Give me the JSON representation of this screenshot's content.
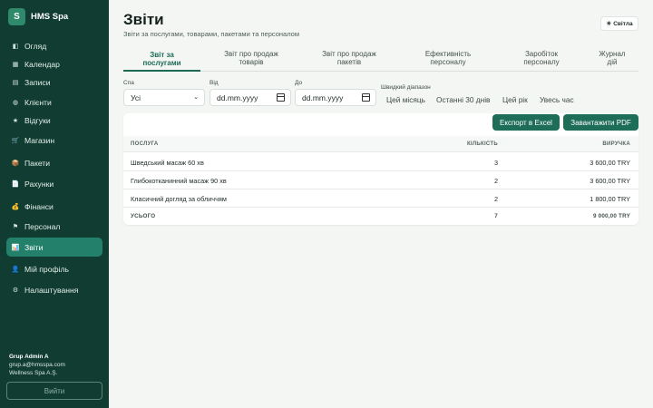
{
  "brand": {
    "logo_letter": "S",
    "name": "HMS Spa"
  },
  "nav": [
    {
      "label": "Огляд",
      "icon": "overview-icon",
      "glyph": "◧"
    },
    {
      "label": "Календар",
      "icon": "calendar-icon",
      "glyph": "▦"
    },
    {
      "label": "Записи",
      "icon": "appointments-icon",
      "glyph": "▤"
    },
    {
      "label": "Клієнти",
      "icon": "clients-icon",
      "glyph": "◍"
    },
    {
      "label": "Відгуки",
      "icon": "star-icon",
      "glyph": "★"
    },
    {
      "label": "Магазин",
      "icon": "shop-icon",
      "glyph": "🛒"
    },
    {
      "label": "Пакети",
      "icon": "package-icon",
      "glyph": "📦"
    },
    {
      "label": "Рахунки",
      "icon": "invoice-icon",
      "glyph": "📄"
    },
    {
      "label": "Фінанси",
      "icon": "finance-icon",
      "glyph": "💰"
    },
    {
      "label": "Персонал",
      "icon": "flag-icon",
      "glyph": "⚑"
    },
    {
      "label": "Звіти",
      "icon": "chart-icon",
      "glyph": "📊",
      "active": true
    },
    {
      "label": "Мій профіль",
      "icon": "profile-icon",
      "glyph": "👤"
    },
    {
      "label": "Налаштування",
      "icon": "gear-icon",
      "glyph": "⚙"
    }
  ],
  "user": {
    "name": "Grup Admin A",
    "email": "grup.a@hmsspa.com",
    "company": "Wellness Spa A.Ş."
  },
  "logout_label": "Вийти",
  "page": {
    "title": "Звіти",
    "subtitle": "Звіти за послугами, товарами, пакетами та персоналом"
  },
  "theme_toggle": {
    "icon": "sun-icon",
    "glyph": "☀",
    "label": "Світла"
  },
  "tabs": [
    {
      "line1": "Звіт за",
      "line2": "послугами",
      "active": true
    },
    {
      "line1": "Звіт про продаж",
      "line2": "товарів"
    },
    {
      "line1": "Звіт про продаж",
      "line2": "пакетів"
    },
    {
      "line1": "Ефективність",
      "line2": "персоналу"
    },
    {
      "line1": "Заробіток",
      "line2": "персоналу"
    },
    {
      "line1": "Журнал",
      "line2": "дій"
    }
  ],
  "filters": {
    "spa_label": "Спа",
    "spa_value": "Усі",
    "from_label": "Від",
    "from_placeholder": "dd.mm.yyyy",
    "to_label": "До",
    "to_placeholder": "dd.mm.yyyy",
    "quick_label": "Швидкий діапазон",
    "quick_ranges": [
      "Цей місяць",
      "Останні 30 днів",
      "Цей рік",
      "Увесь час"
    ]
  },
  "actions": {
    "export_excel": "Експорт в Excel",
    "download_pdf": "Завантажити PDF"
  },
  "table": {
    "columns": [
      "ПОСЛУГА",
      "КІЛЬКІСТЬ",
      "ВИРУЧКА"
    ],
    "rows": [
      {
        "service": "Шведський масаж 60 хв",
        "count": "3",
        "revenue": "3 600,00 TRY"
      },
      {
        "service": "Глибокотканинний масаж 90 хв",
        "count": "2",
        "revenue": "3 600,00 TRY"
      },
      {
        "service": "Класичний догляд за обличчям",
        "count": "2",
        "revenue": "1 800,00 TRY"
      }
    ],
    "total": {
      "label": "УСЬОГО",
      "count": "7",
      "revenue": "9 000,00 TRY"
    }
  },
  "colors": {
    "sidebar": "#103c31",
    "accent": "#1e6d58",
    "active_nav": "#23806a"
  }
}
